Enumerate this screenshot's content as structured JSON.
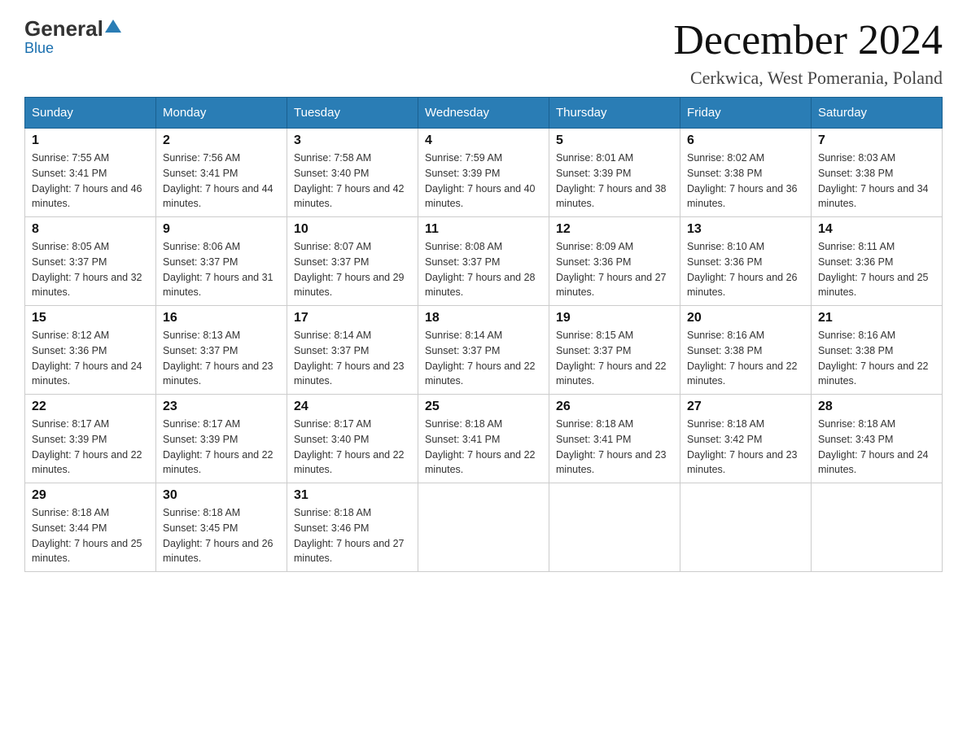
{
  "header": {
    "logo_general": "General",
    "logo_blue": "Blue",
    "month_title": "December 2024",
    "location": "Cerkwica, West Pomerania, Poland"
  },
  "weekdays": [
    "Sunday",
    "Monday",
    "Tuesday",
    "Wednesday",
    "Thursday",
    "Friday",
    "Saturday"
  ],
  "weeks": [
    [
      {
        "day": "1",
        "sunrise": "7:55 AM",
        "sunset": "3:41 PM",
        "daylight": "7 hours and 46 minutes."
      },
      {
        "day": "2",
        "sunrise": "7:56 AM",
        "sunset": "3:41 PM",
        "daylight": "7 hours and 44 minutes."
      },
      {
        "day": "3",
        "sunrise": "7:58 AM",
        "sunset": "3:40 PM",
        "daylight": "7 hours and 42 minutes."
      },
      {
        "day": "4",
        "sunrise": "7:59 AM",
        "sunset": "3:39 PM",
        "daylight": "7 hours and 40 minutes."
      },
      {
        "day": "5",
        "sunrise": "8:01 AM",
        "sunset": "3:39 PM",
        "daylight": "7 hours and 38 minutes."
      },
      {
        "day": "6",
        "sunrise": "8:02 AM",
        "sunset": "3:38 PM",
        "daylight": "7 hours and 36 minutes."
      },
      {
        "day": "7",
        "sunrise": "8:03 AM",
        "sunset": "3:38 PM",
        "daylight": "7 hours and 34 minutes."
      }
    ],
    [
      {
        "day": "8",
        "sunrise": "8:05 AM",
        "sunset": "3:37 PM",
        "daylight": "7 hours and 32 minutes."
      },
      {
        "day": "9",
        "sunrise": "8:06 AM",
        "sunset": "3:37 PM",
        "daylight": "7 hours and 31 minutes."
      },
      {
        "day": "10",
        "sunrise": "8:07 AM",
        "sunset": "3:37 PM",
        "daylight": "7 hours and 29 minutes."
      },
      {
        "day": "11",
        "sunrise": "8:08 AM",
        "sunset": "3:37 PM",
        "daylight": "7 hours and 28 minutes."
      },
      {
        "day": "12",
        "sunrise": "8:09 AM",
        "sunset": "3:36 PM",
        "daylight": "7 hours and 27 minutes."
      },
      {
        "day": "13",
        "sunrise": "8:10 AM",
        "sunset": "3:36 PM",
        "daylight": "7 hours and 26 minutes."
      },
      {
        "day": "14",
        "sunrise": "8:11 AM",
        "sunset": "3:36 PM",
        "daylight": "7 hours and 25 minutes."
      }
    ],
    [
      {
        "day": "15",
        "sunrise": "8:12 AM",
        "sunset": "3:36 PM",
        "daylight": "7 hours and 24 minutes."
      },
      {
        "day": "16",
        "sunrise": "8:13 AM",
        "sunset": "3:37 PM",
        "daylight": "7 hours and 23 minutes."
      },
      {
        "day": "17",
        "sunrise": "8:14 AM",
        "sunset": "3:37 PM",
        "daylight": "7 hours and 23 minutes."
      },
      {
        "day": "18",
        "sunrise": "8:14 AM",
        "sunset": "3:37 PM",
        "daylight": "7 hours and 22 minutes."
      },
      {
        "day": "19",
        "sunrise": "8:15 AM",
        "sunset": "3:37 PM",
        "daylight": "7 hours and 22 minutes."
      },
      {
        "day": "20",
        "sunrise": "8:16 AM",
        "sunset": "3:38 PM",
        "daylight": "7 hours and 22 minutes."
      },
      {
        "day": "21",
        "sunrise": "8:16 AM",
        "sunset": "3:38 PM",
        "daylight": "7 hours and 22 minutes."
      }
    ],
    [
      {
        "day": "22",
        "sunrise": "8:17 AM",
        "sunset": "3:39 PM",
        "daylight": "7 hours and 22 minutes."
      },
      {
        "day": "23",
        "sunrise": "8:17 AM",
        "sunset": "3:39 PM",
        "daylight": "7 hours and 22 minutes."
      },
      {
        "day": "24",
        "sunrise": "8:17 AM",
        "sunset": "3:40 PM",
        "daylight": "7 hours and 22 minutes."
      },
      {
        "day": "25",
        "sunrise": "8:18 AM",
        "sunset": "3:41 PM",
        "daylight": "7 hours and 22 minutes."
      },
      {
        "day": "26",
        "sunrise": "8:18 AM",
        "sunset": "3:41 PM",
        "daylight": "7 hours and 23 minutes."
      },
      {
        "day": "27",
        "sunrise": "8:18 AM",
        "sunset": "3:42 PM",
        "daylight": "7 hours and 23 minutes."
      },
      {
        "day": "28",
        "sunrise": "8:18 AM",
        "sunset": "3:43 PM",
        "daylight": "7 hours and 24 minutes."
      }
    ],
    [
      {
        "day": "29",
        "sunrise": "8:18 AM",
        "sunset": "3:44 PM",
        "daylight": "7 hours and 25 minutes."
      },
      {
        "day": "30",
        "sunrise": "8:18 AM",
        "sunset": "3:45 PM",
        "daylight": "7 hours and 26 minutes."
      },
      {
        "day": "31",
        "sunrise": "8:18 AM",
        "sunset": "3:46 PM",
        "daylight": "7 hours and 27 minutes."
      },
      null,
      null,
      null,
      null
    ]
  ]
}
